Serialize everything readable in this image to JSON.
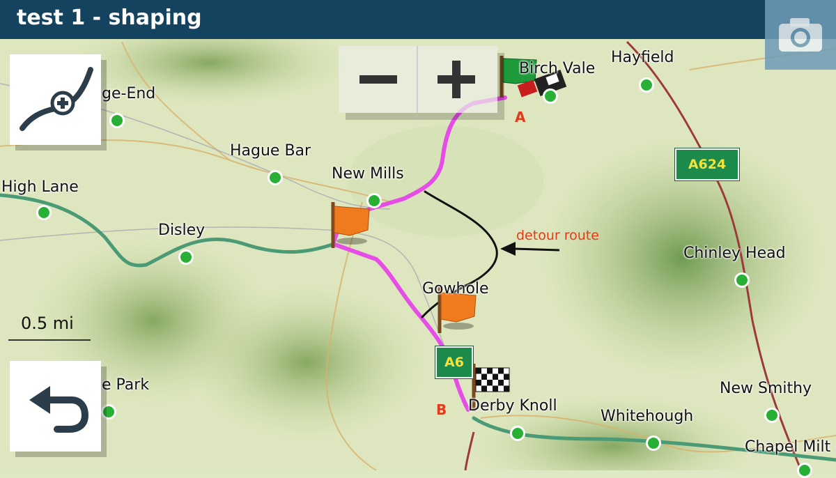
{
  "title": "test 1 - shaping",
  "icons": {
    "camera": "camera-icon",
    "shaping_tool": "curve-add-point-icon",
    "back": "back-arrow-icon",
    "zoom_out": "minus-icon",
    "zoom_in": "plus-icon"
  },
  "zoom": {
    "out_label": "−",
    "in_label": "+"
  },
  "scale": {
    "label": "0.5 mi"
  },
  "route": {
    "start_label": "A",
    "end_label": "B",
    "detour_label": "detour route",
    "route_color": "#e64ce6",
    "detour_color": "#111111"
  },
  "roads": [
    {
      "id": "A624",
      "label": "A624"
    },
    {
      "id": "A6",
      "label": "A6"
    }
  ],
  "places": {
    "hayfield": "Hayfield",
    "birch_vale": "Birch Vale",
    "bridge_end": "ge-End",
    "hague_bar": "Hague Bar",
    "new_mills": "New Mills",
    "high_lane": "High Lane",
    "disley": "Disley",
    "gowhole": "Gowhole",
    "chinley_head": "Chinley Head",
    "derby_knoll": "Derby Knoll",
    "whitehough": "Whitehough",
    "new_smithy": "New Smithy",
    "chapel_milton": "Chapel Milt",
    "park": "e Park"
  },
  "colors": {
    "title_bar": "#14435f",
    "place_dot": "#27b034",
    "road_shield": "#1c8a4b",
    "water": "#4a9a76"
  }
}
